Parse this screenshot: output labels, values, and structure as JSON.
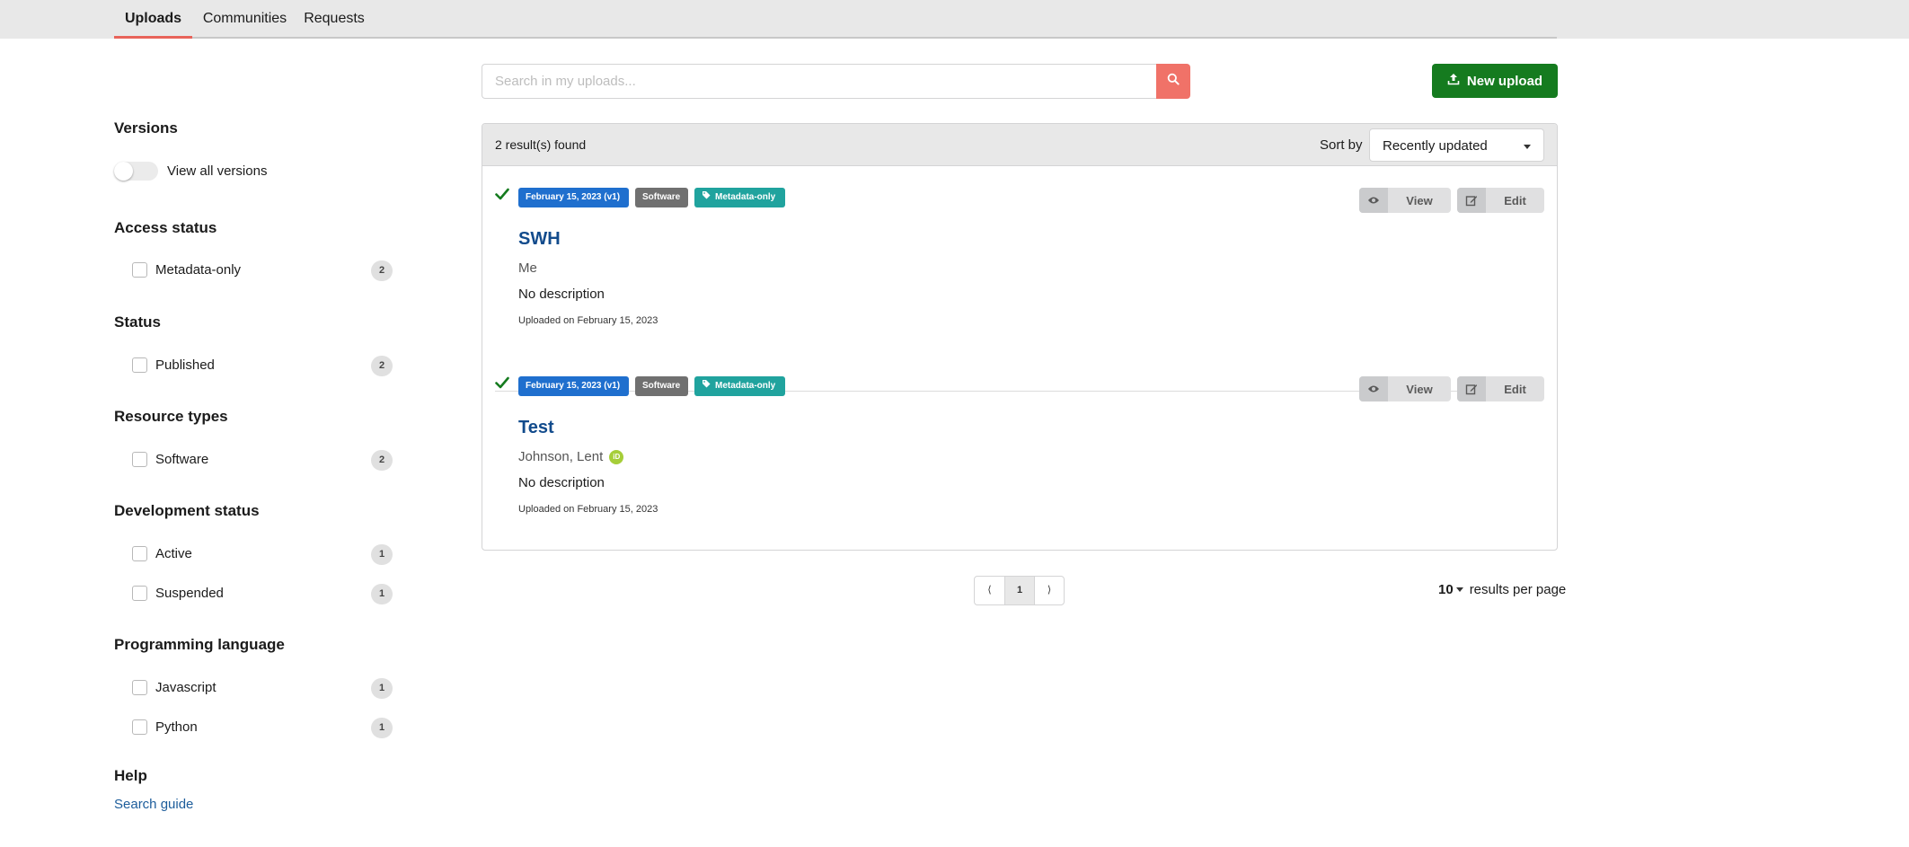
{
  "nav": {
    "tabs": [
      {
        "label": "Uploads",
        "active": true
      },
      {
        "label": "Communities",
        "active": false
      },
      {
        "label": "Requests",
        "active": false
      }
    ]
  },
  "search": {
    "placeholder": "Search in my uploads...",
    "value": "",
    "button_icon": "search-icon"
  },
  "new_upload": {
    "label": "New upload",
    "icon": "upload-icon"
  },
  "facets": {
    "versions": {
      "title": "Versions",
      "toggle_label": "View all versions",
      "toggle_on": false
    },
    "access_status": {
      "title": "Access status",
      "items": [
        {
          "label": "Metadata-only",
          "count": "2",
          "checked": false
        }
      ]
    },
    "status": {
      "title": "Status",
      "items": [
        {
          "label": "Published",
          "count": "2",
          "checked": false
        }
      ]
    },
    "resource_types": {
      "title": "Resource types",
      "items": [
        {
          "label": "Software",
          "count": "2",
          "checked": false
        }
      ]
    },
    "development_status": {
      "title": "Development status",
      "items": [
        {
          "label": "Active",
          "count": "1",
          "checked": false
        },
        {
          "label": "Suspended",
          "count": "1",
          "checked": false
        }
      ]
    },
    "programming_language": {
      "title": "Programming language",
      "items": [
        {
          "label": "Javascript",
          "count": "1",
          "checked": false
        },
        {
          "label": "Python",
          "count": "1",
          "checked": false
        }
      ]
    },
    "help": {
      "title": "Help",
      "link": "Search guide"
    }
  },
  "results": {
    "count_text": "2 result(s) found",
    "sort_label": "Sort by",
    "sort_value": "Recently updated",
    "items": [
      {
        "status_icon": "check-icon",
        "date_badge": "February 15, 2023 (v1)",
        "type_badge": "Software",
        "access_badge": "Metadata-only",
        "title": "SWH",
        "creator": "Me",
        "has_orcid": false,
        "description": "No description",
        "uploaded": "Uploaded on February 15, 2023",
        "view_label": "View",
        "edit_label": "Edit"
      },
      {
        "status_icon": "check-icon",
        "date_badge": "February 15, 2023 (v1)",
        "type_badge": "Software",
        "access_badge": "Metadata-only",
        "title": "Test",
        "creator": "Johnson, Lent",
        "has_orcid": true,
        "description": "No description",
        "uploaded": "Uploaded on February 15, 2023",
        "view_label": "View",
        "edit_label": "Edit"
      }
    ]
  },
  "pagination": {
    "prev": "⟨",
    "current": "1",
    "next": "⟩",
    "per_page": "10",
    "per_page_label": "results per page"
  },
  "colors": {
    "accent_tab": "#e8635a",
    "search_button": "#f07268",
    "new_upload": "#157b1f",
    "date_badge": "#1f6fce",
    "type_badge": "#707070",
    "access_badge": "#20a39e",
    "title_link": "#124b8c",
    "check": "#157b1f",
    "orcid": "#a6ce39"
  }
}
